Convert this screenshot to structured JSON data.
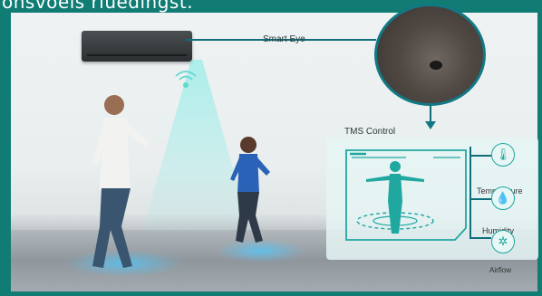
{
  "header": {
    "text": "onsvoels rluedingst."
  },
  "callouts": {
    "smart_eye": "Smart Eye",
    "tms_control": "TMS Control"
  },
  "features": [
    {
      "label": "Temperature",
      "icon": "thermometer-icon"
    },
    {
      "label": "Humidity",
      "icon": "droplet-icon"
    },
    {
      "label": "Airflow",
      "icon": "fan-icon"
    }
  ],
  "colors": {
    "accent": "#117884",
    "cyan": "#1fa7a0",
    "frame": "#107c74"
  }
}
